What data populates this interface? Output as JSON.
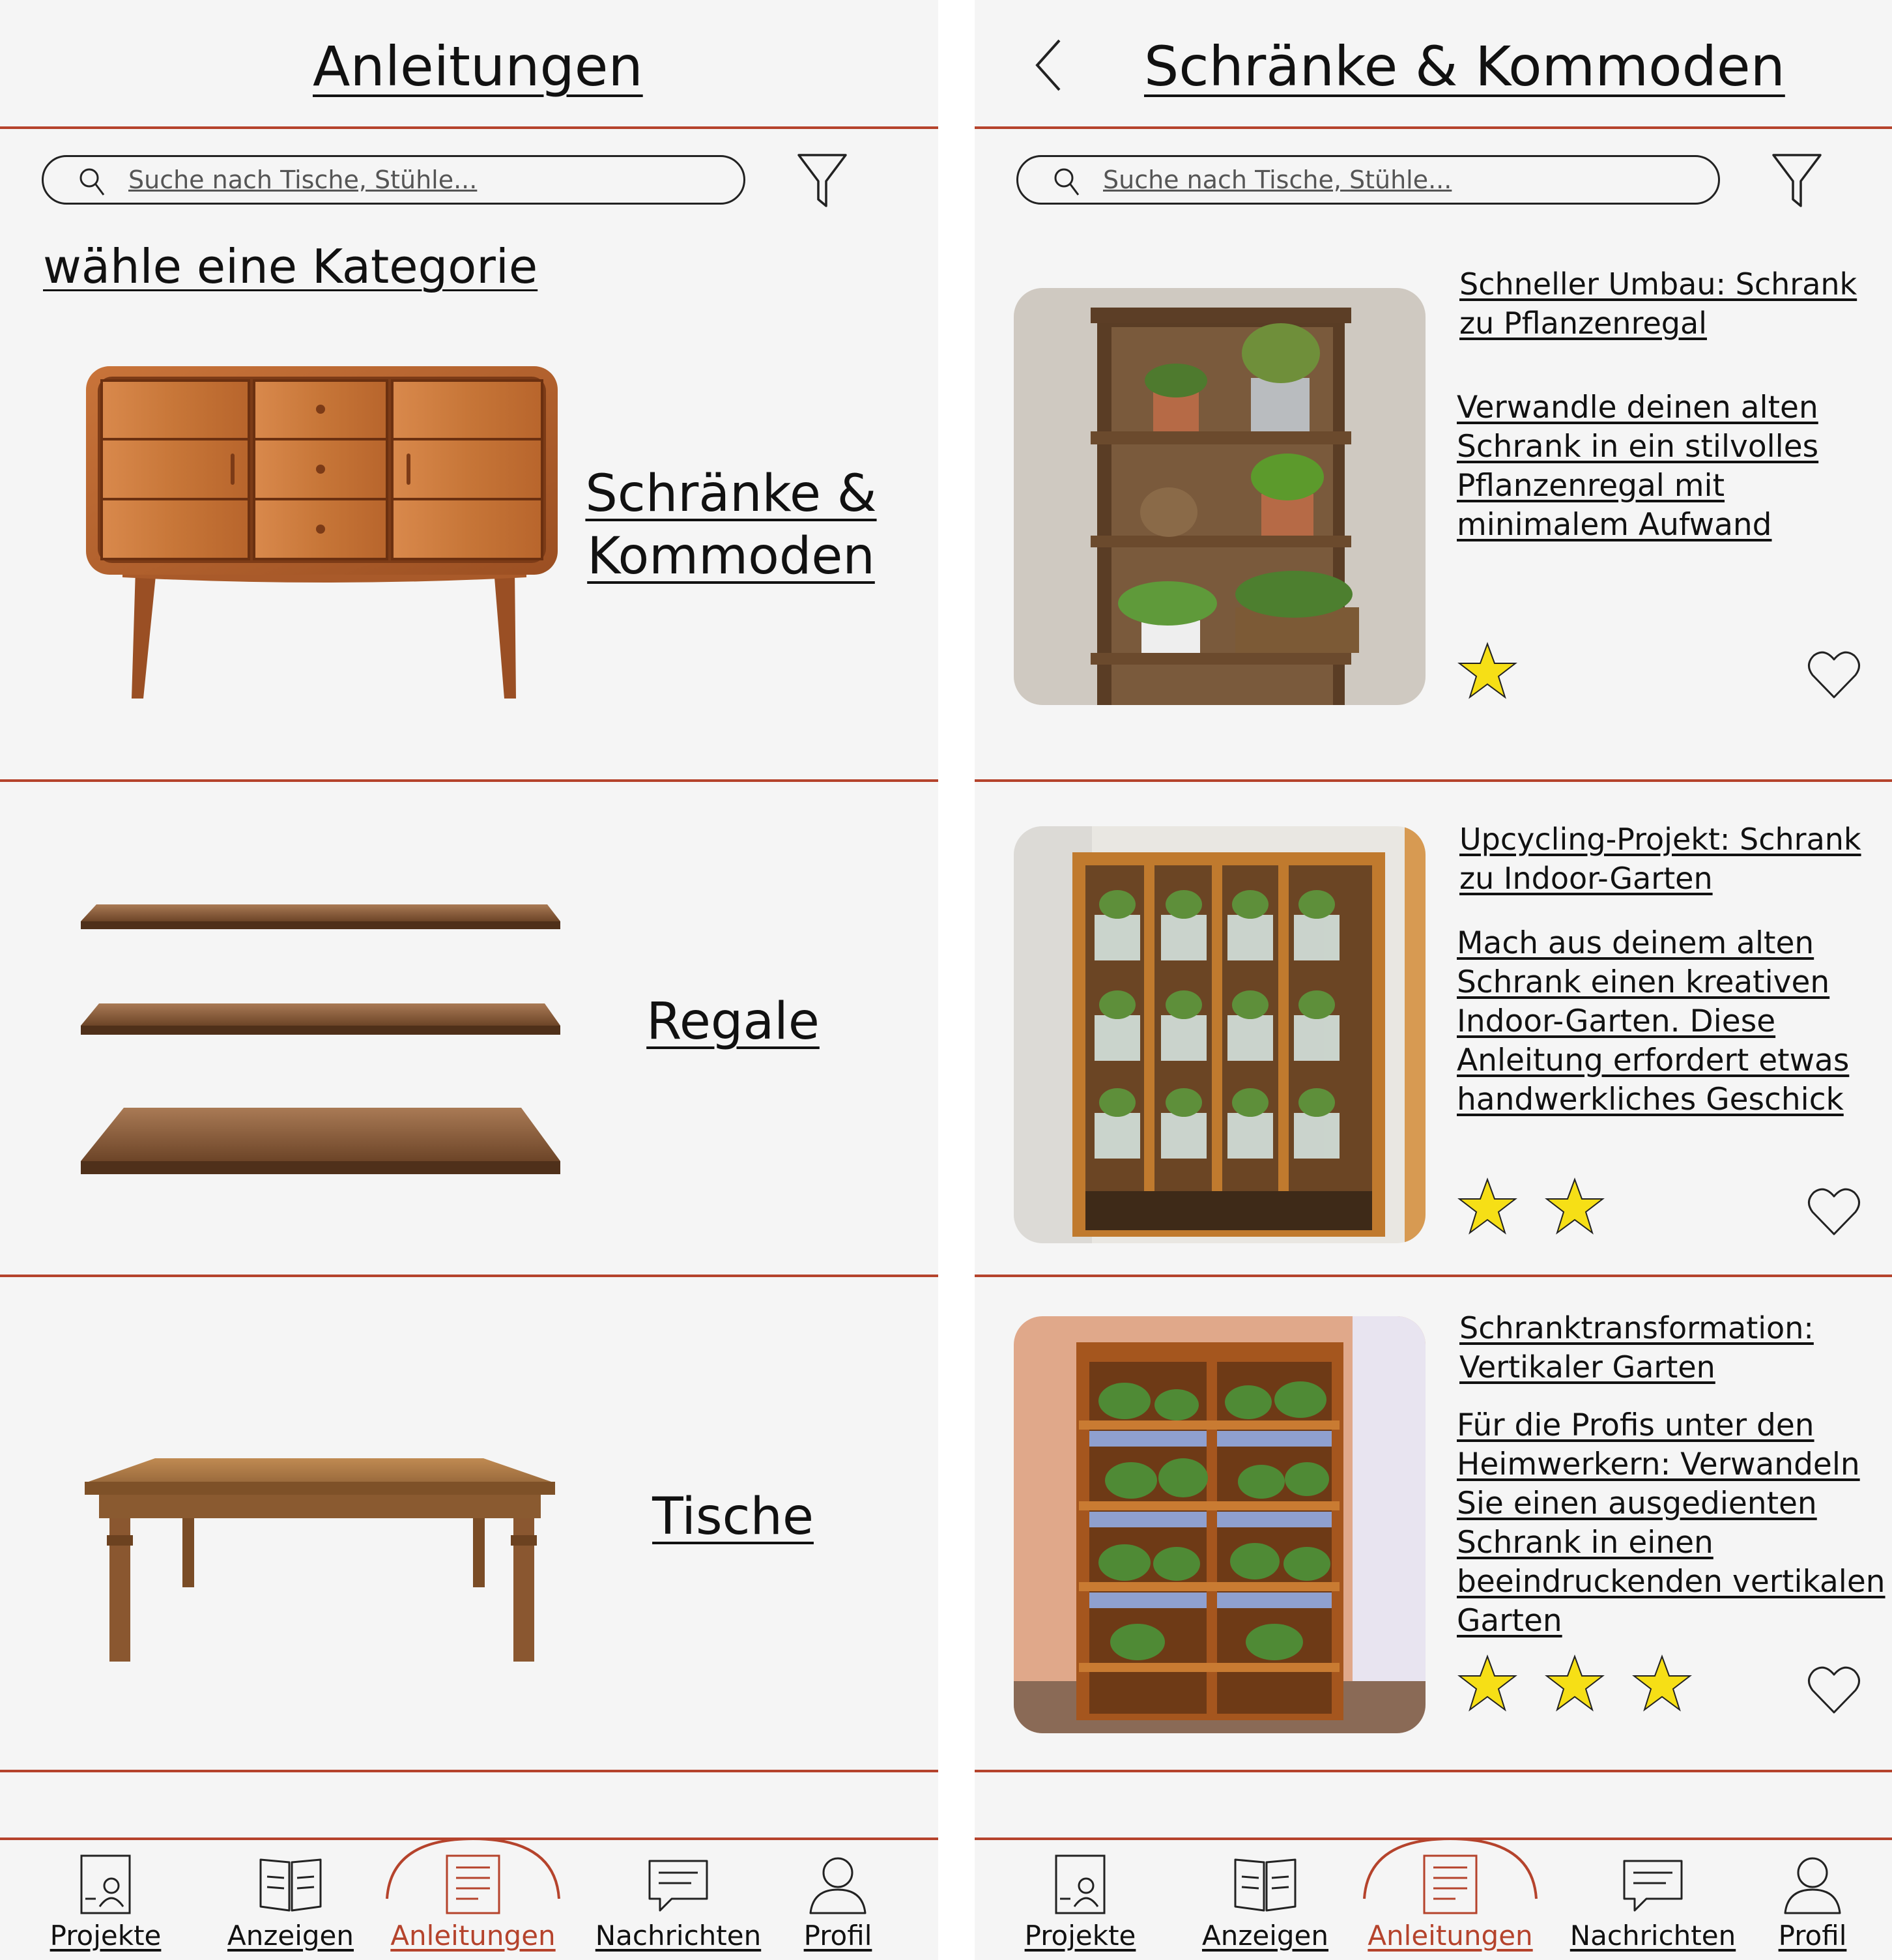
{
  "colors": {
    "accent": "#b5432c",
    "star": "#f6df16",
    "background": "#f5f5f5"
  },
  "left": {
    "title": "Anleitungen",
    "search_placeholder": "Suche nach Tische, Stühle...",
    "subtitle": "wähle eine Kategorie",
    "categories": [
      {
        "label": "Schränke &\nKommoden",
        "icon": "sideboard-image"
      },
      {
        "label": "Regale",
        "icon": "shelves-image"
      },
      {
        "label": "Tische",
        "icon": "table-image"
      }
    ]
  },
  "right": {
    "title": "Schränke & Kommoden",
    "search_placeholder": "Suche nach Tische, Stühle...",
    "cards": [
      {
        "title": "Schneller Umbau: Schrank zu Pflanzenregal",
        "description": "Verwandle deinen alten Schrank in ein stilvolles Pflanzenregal mit minimalem Aufwand",
        "rating": 1
      },
      {
        "title": "Upcycling-Projekt: Schrank zu Indoor-Garten",
        "description": "Mach aus deinem alten Schrank einen kreativen Indoor-Garten. Diese Anleitung erfordert etwas handwerkliches Geschick",
        "rating": 2
      },
      {
        "title": "Schranktransformation: Vertikaler Garten",
        "description": "Für die Profis unter den Heimwerkern: Verwandeln Sie einen ausgedienten Schrank in einen beeindruckenden vertikalen Garten",
        "rating": 3
      }
    ]
  },
  "nav": {
    "items": [
      {
        "label": "Projekte",
        "icon": "projects-icon"
      },
      {
        "label": "Anzeigen",
        "icon": "book-icon"
      },
      {
        "label": "Anleitungen",
        "icon": "document-icon",
        "active": true
      },
      {
        "label": "Nachrichten",
        "icon": "message-icon"
      },
      {
        "label": "Profil",
        "icon": "user-icon"
      }
    ]
  }
}
